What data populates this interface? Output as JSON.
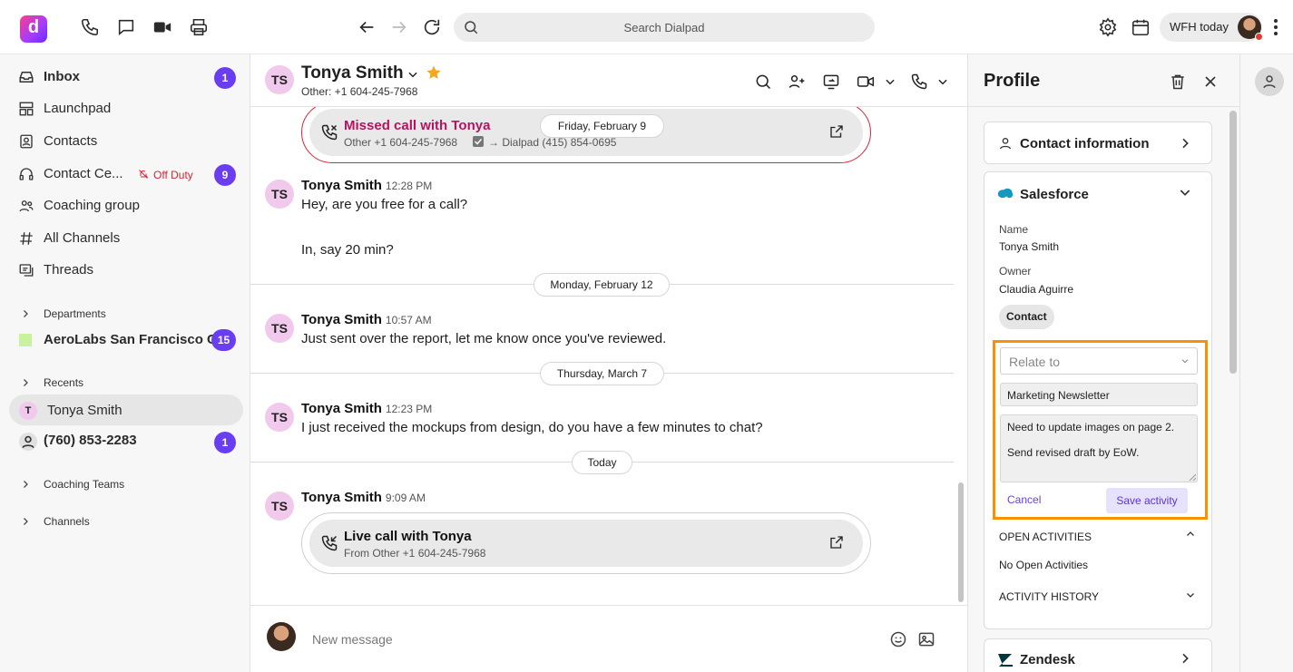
{
  "topbar": {
    "search_placeholder": "Search Dialpad",
    "status_label": "WFH today"
  },
  "sidebar": {
    "items": [
      {
        "label": "Inbox",
        "badge": "1"
      },
      {
        "label": "Launchpad"
      },
      {
        "label": "Contacts"
      },
      {
        "label": "Contact Ce...",
        "status": "Off Duty",
        "badge": "9"
      },
      {
        "label": "Coaching group"
      },
      {
        "label": "All Channels"
      },
      {
        "label": "Threads"
      }
    ],
    "departments_label": "Departments",
    "department": {
      "label": "AeroLabs San Francisco CA",
      "badge": "15"
    },
    "recents_label": "Recents",
    "recents": [
      {
        "initial": "T",
        "label": "Tonya Smith"
      },
      {
        "label": "(760) 853-2283",
        "badge": "1"
      }
    ],
    "coaching_teams_label": "Coaching Teams",
    "channels_label": "Channels"
  },
  "conversation": {
    "contact_initials": "TS",
    "contact_name": "Tonya Smith",
    "contact_sub": "Other: +1 604-245-7968",
    "missed_call": {
      "title": "Missed call with Tonya",
      "detail_from": "Other +1 604-245-7968",
      "detail_to": "→ Dialpad (415) 854-0695",
      "date_pill": "Friday, February 9"
    },
    "messages": [
      {
        "name": "Tonya Smith",
        "time": "12:28 PM",
        "lines": [
          "Hey, are you free for a call?",
          "In, say 20 min?"
        ]
      },
      {
        "name": "Tonya Smith",
        "time": "10:57 AM",
        "lines": [
          "Just sent over the report, let me know once you've reviewed."
        ]
      },
      {
        "name": "Tonya Smith",
        "time": "12:23 PM",
        "lines": [
          "I just received the mockups from design, do you have a few minutes to chat?"
        ]
      },
      {
        "name": "Tonya Smith",
        "time": "9:09 AM",
        "lines": []
      }
    ],
    "date_dividers": [
      "Monday, February 12",
      "Thursday, March 7",
      "Today"
    ],
    "live_call": {
      "title": "Live call with Tonya",
      "detail": "From Other +1 604-245-7968"
    },
    "composer_placeholder": "New message"
  },
  "profile": {
    "title": "Profile",
    "contact_info_label": "Contact information",
    "salesforce": {
      "title": "Salesforce",
      "name_label": "Name",
      "name_value": "Tonya Smith",
      "owner_label": "Owner",
      "owner_value": "Claudia Aguirre",
      "type_chip": "Contact",
      "relate_to_placeholder": "Relate to",
      "subject_value": "Marketing Newsletter",
      "notes_line1": "Need to update images on page 2.",
      "notes_line2": "Send revised draft by EoW.",
      "cancel_label": "Cancel",
      "save_label": "Save activity",
      "open_activities_label": "OPEN ACTIVITIES",
      "no_open_activities": "No Open Activities",
      "activity_history_label": "ACTIVITY HISTORY"
    },
    "zendesk_label": "Zendesk"
  },
  "colors": {
    "accent": "#6b3df1",
    "missed": "#b3135f",
    "highlight_border": "#f59300",
    "star": "#f4a623"
  }
}
